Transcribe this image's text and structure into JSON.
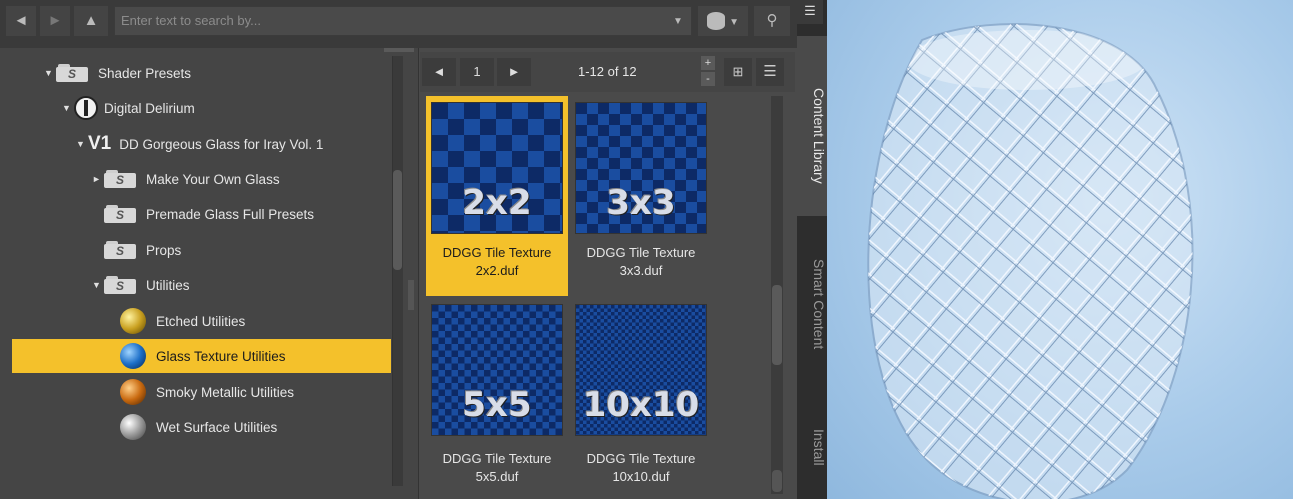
{
  "toolbar": {
    "back_icon": "arrow-left-icon",
    "forward_icon": "arrow-right-icon",
    "up_icon": "arrow-up-icon",
    "search_placeholder": "Enter text to search by...",
    "database_icon": "database-icon",
    "magnifier_icon": "search-icon"
  },
  "tree": {
    "items": [
      {
        "label": "Shader Presets",
        "icon": "shader-folder-icon",
        "expanded": true
      },
      {
        "label": "Digital Delirium",
        "icon": "digital-delirium-logo-icon",
        "expanded": true
      },
      {
        "label": "DD Gorgeous Glass for Iray Vol. 1",
        "prefix": "V1",
        "expanded": true
      },
      {
        "label": "Make Your Own Glass",
        "icon": "shader-folder-icon",
        "expanded": false
      },
      {
        "label": "Premade Glass Full Presets",
        "icon": "shader-folder-icon"
      },
      {
        "label": "Props",
        "icon": "shader-folder-icon"
      },
      {
        "label": "Utilities",
        "icon": "shader-folder-icon",
        "expanded": true
      },
      {
        "label": "Etched Utilities",
        "icon": "gold-sphere-icon"
      },
      {
        "label": "Glass Texture Utilities",
        "icon": "blue-sphere-icon",
        "selected": true
      },
      {
        "label": "Smoky Metallic Utilities",
        "icon": "orange-sphere-icon"
      },
      {
        "label": "Wet Surface Utilities",
        "icon": "silver-sphere-icon"
      }
    ]
  },
  "pager": {
    "page": "1",
    "range": "1-12 of 12",
    "view_icons": [
      "grid-view-icon",
      "list-view-icon"
    ]
  },
  "thumbnails": [
    {
      "label": "2x2",
      "caption1": "DDGG Tile Texture",
      "caption2": "2x2.duf",
      "selected": true
    },
    {
      "label": "3x3",
      "caption1": "DDGG Tile Texture",
      "caption2": "3x3.duf"
    },
    {
      "label": "5x5",
      "caption1": "DDGG Tile Texture",
      "caption2": "5x5.duf"
    },
    {
      "label": "10x10",
      "caption1": "DDGG Tile Texture",
      "caption2": "10x10.duf"
    }
  ],
  "side_tabs": [
    "Content Library",
    "Smart Content",
    "Install"
  ],
  "colors": {
    "selection": "#f4c12b",
    "panel": "#454545"
  }
}
